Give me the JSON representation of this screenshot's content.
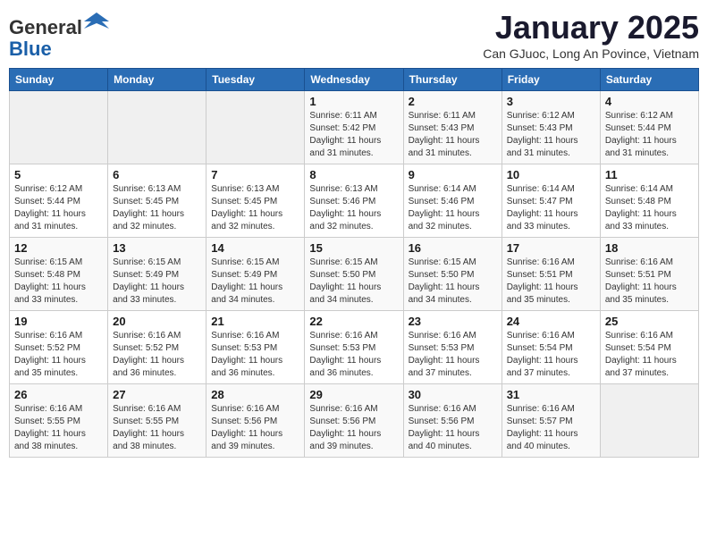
{
  "header": {
    "logo_line1": "General",
    "logo_line2": "Blue",
    "month_title": "January 2025",
    "subtitle": "Can GJuoc, Long An Povince, Vietnam"
  },
  "weekdays": [
    "Sunday",
    "Monday",
    "Tuesday",
    "Wednesday",
    "Thursday",
    "Friday",
    "Saturday"
  ],
  "weeks": [
    [
      {
        "day": "",
        "info": ""
      },
      {
        "day": "",
        "info": ""
      },
      {
        "day": "",
        "info": ""
      },
      {
        "day": "1",
        "info": "Sunrise: 6:11 AM\nSunset: 5:42 PM\nDaylight: 11 hours\nand 31 minutes."
      },
      {
        "day": "2",
        "info": "Sunrise: 6:11 AM\nSunset: 5:43 PM\nDaylight: 11 hours\nand 31 minutes."
      },
      {
        "day": "3",
        "info": "Sunrise: 6:12 AM\nSunset: 5:43 PM\nDaylight: 11 hours\nand 31 minutes."
      },
      {
        "day": "4",
        "info": "Sunrise: 6:12 AM\nSunset: 5:44 PM\nDaylight: 11 hours\nand 31 minutes."
      }
    ],
    [
      {
        "day": "5",
        "info": "Sunrise: 6:12 AM\nSunset: 5:44 PM\nDaylight: 11 hours\nand 31 minutes."
      },
      {
        "day": "6",
        "info": "Sunrise: 6:13 AM\nSunset: 5:45 PM\nDaylight: 11 hours\nand 32 minutes."
      },
      {
        "day": "7",
        "info": "Sunrise: 6:13 AM\nSunset: 5:45 PM\nDaylight: 11 hours\nand 32 minutes."
      },
      {
        "day": "8",
        "info": "Sunrise: 6:13 AM\nSunset: 5:46 PM\nDaylight: 11 hours\nand 32 minutes."
      },
      {
        "day": "9",
        "info": "Sunrise: 6:14 AM\nSunset: 5:46 PM\nDaylight: 11 hours\nand 32 minutes."
      },
      {
        "day": "10",
        "info": "Sunrise: 6:14 AM\nSunset: 5:47 PM\nDaylight: 11 hours\nand 33 minutes."
      },
      {
        "day": "11",
        "info": "Sunrise: 6:14 AM\nSunset: 5:48 PM\nDaylight: 11 hours\nand 33 minutes."
      }
    ],
    [
      {
        "day": "12",
        "info": "Sunrise: 6:15 AM\nSunset: 5:48 PM\nDaylight: 11 hours\nand 33 minutes."
      },
      {
        "day": "13",
        "info": "Sunrise: 6:15 AM\nSunset: 5:49 PM\nDaylight: 11 hours\nand 33 minutes."
      },
      {
        "day": "14",
        "info": "Sunrise: 6:15 AM\nSunset: 5:49 PM\nDaylight: 11 hours\nand 34 minutes."
      },
      {
        "day": "15",
        "info": "Sunrise: 6:15 AM\nSunset: 5:50 PM\nDaylight: 11 hours\nand 34 minutes."
      },
      {
        "day": "16",
        "info": "Sunrise: 6:15 AM\nSunset: 5:50 PM\nDaylight: 11 hours\nand 34 minutes."
      },
      {
        "day": "17",
        "info": "Sunrise: 6:16 AM\nSunset: 5:51 PM\nDaylight: 11 hours\nand 35 minutes."
      },
      {
        "day": "18",
        "info": "Sunrise: 6:16 AM\nSunset: 5:51 PM\nDaylight: 11 hours\nand 35 minutes."
      }
    ],
    [
      {
        "day": "19",
        "info": "Sunrise: 6:16 AM\nSunset: 5:52 PM\nDaylight: 11 hours\nand 35 minutes."
      },
      {
        "day": "20",
        "info": "Sunrise: 6:16 AM\nSunset: 5:52 PM\nDaylight: 11 hours\nand 36 minutes."
      },
      {
        "day": "21",
        "info": "Sunrise: 6:16 AM\nSunset: 5:53 PM\nDaylight: 11 hours\nand 36 minutes."
      },
      {
        "day": "22",
        "info": "Sunrise: 6:16 AM\nSunset: 5:53 PM\nDaylight: 11 hours\nand 36 minutes."
      },
      {
        "day": "23",
        "info": "Sunrise: 6:16 AM\nSunset: 5:53 PM\nDaylight: 11 hours\nand 37 minutes."
      },
      {
        "day": "24",
        "info": "Sunrise: 6:16 AM\nSunset: 5:54 PM\nDaylight: 11 hours\nand 37 minutes."
      },
      {
        "day": "25",
        "info": "Sunrise: 6:16 AM\nSunset: 5:54 PM\nDaylight: 11 hours\nand 37 minutes."
      }
    ],
    [
      {
        "day": "26",
        "info": "Sunrise: 6:16 AM\nSunset: 5:55 PM\nDaylight: 11 hours\nand 38 minutes."
      },
      {
        "day": "27",
        "info": "Sunrise: 6:16 AM\nSunset: 5:55 PM\nDaylight: 11 hours\nand 38 minutes."
      },
      {
        "day": "28",
        "info": "Sunrise: 6:16 AM\nSunset: 5:56 PM\nDaylight: 11 hours\nand 39 minutes."
      },
      {
        "day": "29",
        "info": "Sunrise: 6:16 AM\nSunset: 5:56 PM\nDaylight: 11 hours\nand 39 minutes."
      },
      {
        "day": "30",
        "info": "Sunrise: 6:16 AM\nSunset: 5:56 PM\nDaylight: 11 hours\nand 40 minutes."
      },
      {
        "day": "31",
        "info": "Sunrise: 6:16 AM\nSunset: 5:57 PM\nDaylight: 11 hours\nand 40 minutes."
      },
      {
        "day": "",
        "info": ""
      }
    ]
  ]
}
